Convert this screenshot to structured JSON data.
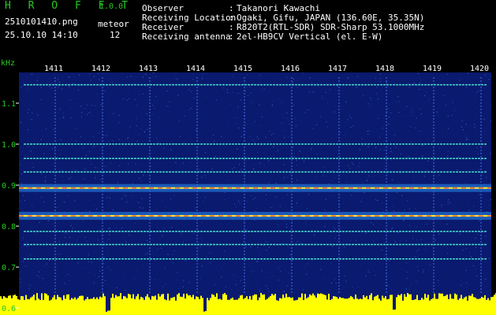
{
  "header": {
    "app_name": "H R O F F T",
    "version": "1.0.0",
    "file_name": "2510101410.png",
    "datetime": "25.10.10 14:10",
    "meteor_label": "meteor",
    "meteor_count": "12",
    "info": [
      {
        "label": "Observer",
        "value": "Takanori Kawachi"
      },
      {
        "label": "Receiving Location",
        "value": "Ogaki, Gifu, JAPAN (136.60E, 35.35N)"
      },
      {
        "label": "Receiver",
        "value": "R820T2(RTL-SDR) SDR-Sharp 53.1000MHz"
      },
      {
        "label": "Receiving antenna",
        "value": "2el-HB9CV Vertical (el. E-W)"
      }
    ],
    "colon": ":"
  },
  "chart_data": {
    "type": "heatmap",
    "ylabel": "kHz",
    "x_ticks": [
      "1411",
      "1412",
      "1413",
      "1414",
      "1415",
      "1416",
      "1417",
      "1418",
      "1419",
      "1420"
    ],
    "y_ticks": [
      "1.1",
      "1.0",
      "0.9",
      "0.8",
      "0.7",
      "0.6"
    ],
    "y_tick_values": [
      1.1,
      1.0,
      0.9,
      0.8,
      0.7,
      0.6
    ],
    "ylim": [
      0.583,
      1.175
    ],
    "carrier_lines_khz": [
      1.145,
      1.0,
      0.965,
      0.932,
      0.893,
      0.825,
      0.787,
      0.755,
      0.72
    ],
    "colors": {
      "background": "#0a1a6e",
      "tick_text": "#ffffff",
      "axis_text": "#22cc22",
      "carrier": "#44ddcc",
      "strong": "#ff3333",
      "meter": "#ffff00"
    }
  }
}
